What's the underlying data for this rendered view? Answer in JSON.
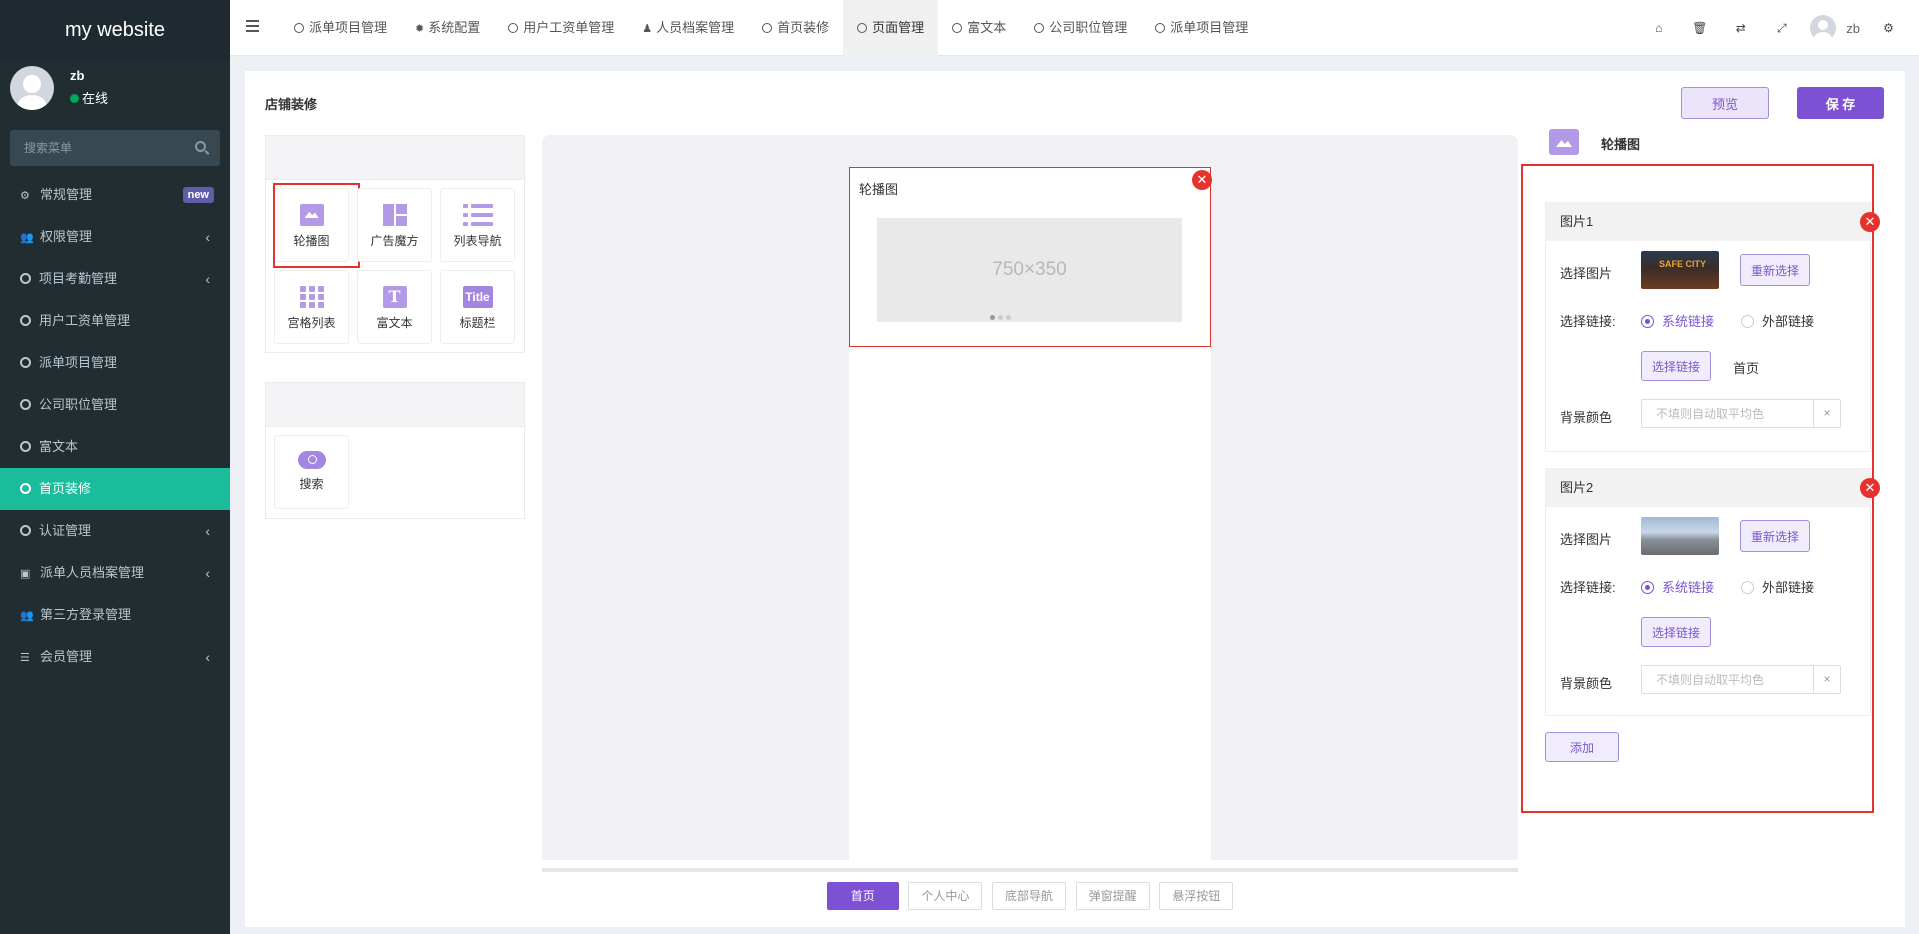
{
  "brand": "my website",
  "user": {
    "name": "zb",
    "status": "在线"
  },
  "sidebar": {
    "search_placeholder": "搜索菜单",
    "items": [
      {
        "label": "常规管理",
        "badge": "new"
      },
      {
        "label": "权限管理",
        "chevron": "‹"
      },
      {
        "label": "项目考勤管理",
        "chevron": "‹"
      },
      {
        "label": "用户工资单管理"
      },
      {
        "label": "派单项目管理"
      },
      {
        "label": "公司职位管理"
      },
      {
        "label": "富文本"
      },
      {
        "label": "首页装修"
      },
      {
        "label": "认证管理",
        "chevron": "‹"
      },
      {
        "label": "派单人员档案管理",
        "chevron": "‹"
      },
      {
        "label": "第三方登录管理"
      },
      {
        "label": "会员管理",
        "chevron": "‹"
      }
    ]
  },
  "topnav": {
    "tabs": [
      "派单项目管理",
      "系统配置",
      "用户工资单管理",
      "人员档案管理",
      "首页装修",
      "页面管理",
      "富文本",
      "公司职位管理",
      "派单项目管理"
    ],
    "user": "zb"
  },
  "page": {
    "title": "店铺装修",
    "preview_label": "预览",
    "save_label": "保 存"
  },
  "components": {
    "group1": [
      {
        "label": "轮播图",
        "icon": "carousel-icon"
      },
      {
        "label": "广告魔方",
        "icon": "ad-cube-icon"
      },
      {
        "label": "列表导航",
        "icon": "list-nav-icon"
      },
      {
        "label": "宫格列表",
        "icon": "grid-list-icon"
      },
      {
        "label": "富文本",
        "icon": "rich-text-icon"
      },
      {
        "label": "标题栏",
        "icon": "title-bar-icon"
      }
    ],
    "title_icon_text": "Title",
    "rich_icon_text": "T",
    "group2": [
      {
        "label": "搜索",
        "icon": "search-component-icon"
      }
    ]
  },
  "canvas": {
    "block_title": "轮播图",
    "placeholder": "750×350",
    "bottom_tabs": [
      "首页",
      "个人中心",
      "底部导航",
      "弹窗提醒",
      "悬浮按钮"
    ]
  },
  "editor": {
    "title": "轮播图",
    "images": [
      {
        "name": "图片1",
        "select_image_label": "选择图片",
        "thumb_text": "SAFE CITY",
        "reselect_label": "重新选择",
        "link_label": "选择链接:",
        "system_link": "系统链接",
        "external_link": "外部链接",
        "choose_link_label": "选择链接",
        "link_value": "首页",
        "bg_color_label": "背景颜色",
        "bg_color_placeholder": "不填则自动取平均色",
        "bg_color_value": ""
      },
      {
        "name": "图片2",
        "select_image_label": "选择图片",
        "reselect_label": "重新选择",
        "link_label": "选择链接:",
        "system_link": "系统链接",
        "external_link": "外部链接",
        "choose_link_label": "选择链接",
        "link_value": "",
        "bg_color_label": "背景颜色",
        "bg_color_placeholder": "不填则自动取平均色",
        "bg_color_value": ""
      }
    ],
    "add_label": "添加"
  },
  "colors": {
    "accent": "#7d51d3",
    "sidebar_bg": "#222d32",
    "active_menu": "#1abc9c",
    "highlight": "#e5322d"
  }
}
